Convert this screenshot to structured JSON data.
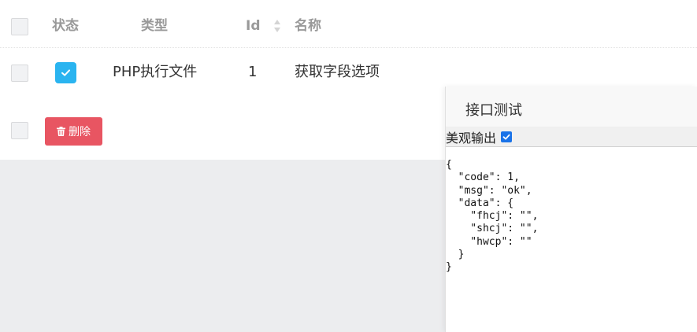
{
  "table": {
    "headers": {
      "status": "状态",
      "type": "类型",
      "id": "Id",
      "name": "名称"
    },
    "rows": [
      {
        "status": true,
        "type": "PHP执行文件",
        "id": "1",
        "name": "获取字段选项"
      }
    ],
    "delete_button_label": "删除"
  },
  "panel": {
    "title": "接口测试",
    "pretty_output_label": "美观输出",
    "pretty_output_checked": true,
    "output": "{\n  \"code\": 1,\n  \"msg\": \"ok\",\n  \"data\": {\n    \"fhcj\": \"\",\n    \"shcj\": \"\",\n    \"hwcp\": \"\"\n  }\n}"
  },
  "colors": {
    "accent_blue": "#2ab4f0",
    "danger_red": "#e85562",
    "checkbox_blue": "#1a73e8"
  }
}
